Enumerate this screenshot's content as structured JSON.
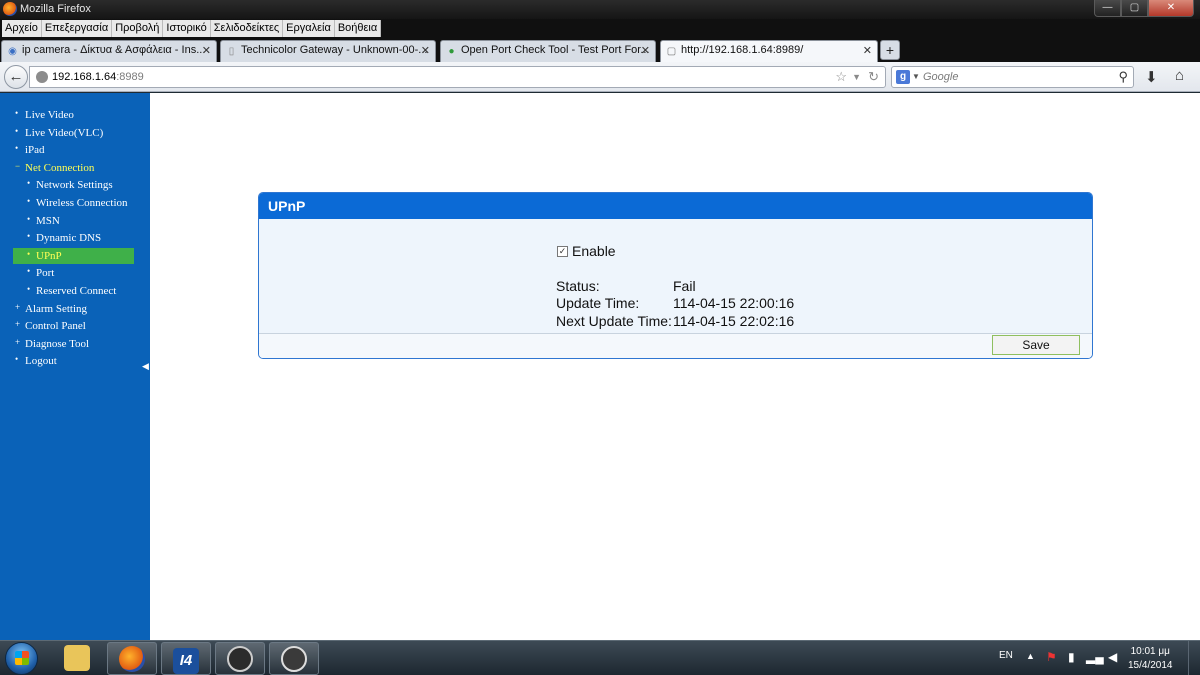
{
  "window": {
    "title": "Mozilla Firefox",
    "min": "—",
    "max": "▢",
    "close": "✕"
  },
  "menubar": [
    "Αρχείο",
    "Επεξεργασία",
    "Προβολή",
    "Ιστορικό",
    "Σελιδοδείκτες",
    "Εργαλεία",
    "Βοήθεια"
  ],
  "tabs": [
    {
      "label": "ip camera - Δίκτυα & Ασφάλεια - Ins...",
      "icon": "forum-icon"
    },
    {
      "label": "Technicolor Gateway - Unknown-00-...",
      "icon": "page-icon"
    },
    {
      "label": "Open Port Check Tool - Test Port For...",
      "icon": "globe-icon"
    },
    {
      "label": "http://192.168.1.64:8989/",
      "icon": "blank-page-icon"
    }
  ],
  "newtab_label": "+",
  "url": {
    "host": "192.168.1.64",
    "port": ":8989"
  },
  "search": {
    "placeholder": "Google"
  },
  "sidebar": {
    "items": [
      {
        "label": "Live Video",
        "level": 1,
        "bullet": "•"
      },
      {
        "label": "Live Video(VLC)",
        "level": 1,
        "bullet": "•"
      },
      {
        "label": "iPad",
        "level": 1,
        "bullet": "•"
      },
      {
        "label": "Net Connection",
        "level": 1,
        "bullet": "−"
      },
      {
        "label": "Network Settings",
        "level": 2,
        "bullet": "•"
      },
      {
        "label": "Wireless Connection",
        "level": 2,
        "bullet": "•"
      },
      {
        "label": "MSN",
        "level": 2,
        "bullet": "•"
      },
      {
        "label": "Dynamic DNS",
        "level": 2,
        "bullet": "•"
      },
      {
        "label": "UPnP",
        "level": 2,
        "bullet": "•"
      },
      {
        "label": "Port",
        "level": 2,
        "bullet": "•"
      },
      {
        "label": "Reserved Connect",
        "level": 2,
        "bullet": "•"
      },
      {
        "label": "Alarm Setting",
        "level": 1,
        "bullet": "+"
      },
      {
        "label": "Control Panel",
        "level": 1,
        "bullet": "+"
      },
      {
        "label": "Diagnose Tool",
        "level": 1,
        "bullet": "+"
      },
      {
        "label": "Logout",
        "level": 1,
        "bullet": "•"
      }
    ],
    "open_item": "Net Connection",
    "active_item": "UPnP"
  },
  "panel": {
    "title": "UPnP",
    "enable_label": "Enable",
    "enable_checked": true,
    "status_label": "Status:",
    "status_value": "Fail",
    "update_time_label": "Update Time:",
    "update_time_value": "114-04-15 22:00:16",
    "next_update_label": "Next Update Time:",
    "next_update_value": "114-04-15 22:02:16",
    "save_label": "Save"
  },
  "taskbar": {
    "lang": "EN",
    "time": "10:01 μμ",
    "date": "15/4/2014",
    "apps": [
      "folder-icon",
      "firefox-icon",
      "i4-icon",
      "steam-icon",
      "gs-icon"
    ],
    "i4_label": "I4"
  },
  "colors": {
    "sidebar_bg": "#0a62b8",
    "sidebar_active": "#3fb049",
    "sidebar_highlight_text": "#ffff55",
    "panel_header": "#0b6ad6",
    "panel_body": "#eef5fc"
  }
}
